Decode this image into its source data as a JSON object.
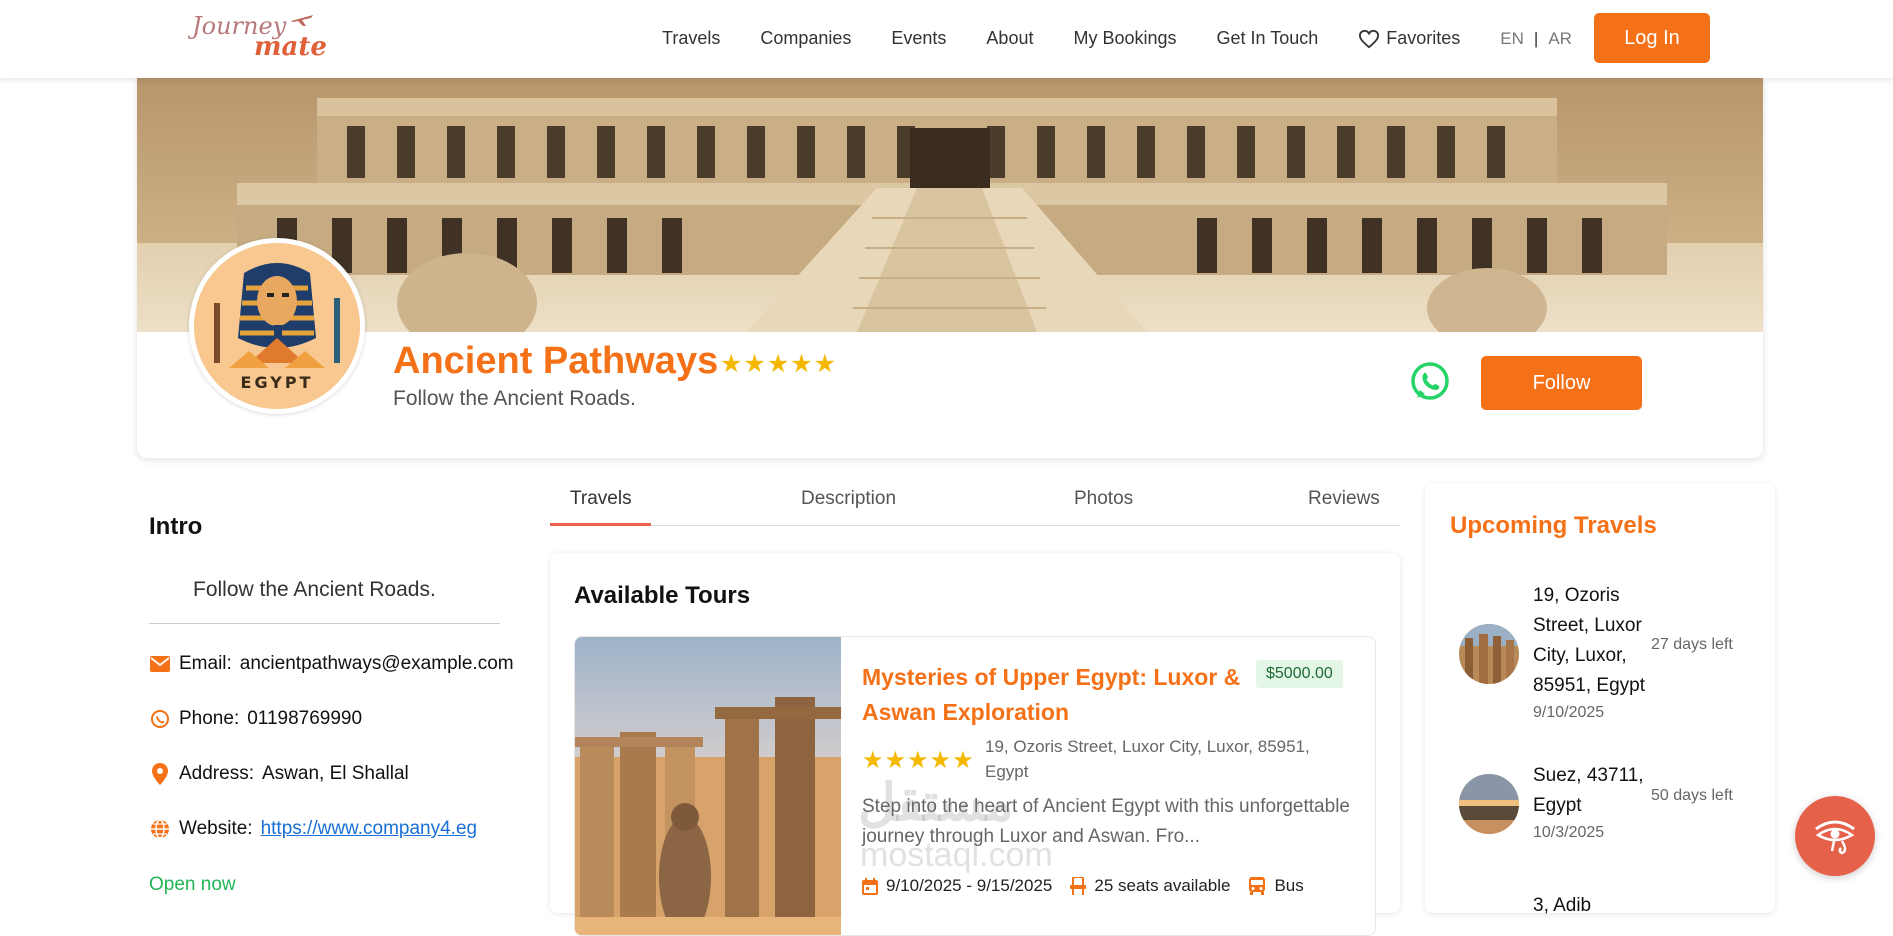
{
  "brand": {
    "logo_line1": "Journey",
    "logo_line2": "mate"
  },
  "nav": {
    "links": [
      "Travels",
      "Companies",
      "Events",
      "About",
      "My Bookings",
      "Get In Touch"
    ],
    "favorites": "Favorites",
    "lang_en": "EN",
    "lang_sep": "|",
    "lang_ar": "AR",
    "login": "Log In"
  },
  "company": {
    "name": "Ancient Pathways",
    "rating_stars": "★★★★★",
    "tagline": "Follow the Ancient Roads.",
    "follow": "Follow",
    "avatar_text": "EGYPT"
  },
  "intro": {
    "title": "Intro",
    "text": "Follow the Ancient Roads.",
    "email_label": "Email:",
    "email": "ancientpathways@example.com",
    "phone_label": "Phone:",
    "phone": "01198769990",
    "address_label": "Address:",
    "address": "Aswan, El Shallal",
    "website_label": "Website:",
    "website": "https://www.company4.eg",
    "status": "Open now"
  },
  "tabs": [
    "Travels",
    "Description",
    "Photos",
    "Reviews"
  ],
  "tours": {
    "title": "Available Tours",
    "items": [
      {
        "title": "Mysteries of Upper Egypt: Luxor & Aswan Exploration",
        "price": "$5000.00",
        "stars": "★★★★★",
        "address": "19, Ozoris Street, Luxor City, Luxor, 85951, Egypt",
        "description": "Step into the heart of Ancient Egypt with this unforgettable journey through Luxor and Aswan. Fro...",
        "dates": "9/10/2025 - 9/15/2025",
        "seats": "25 seats available",
        "transport": "Bus"
      }
    ]
  },
  "upcoming": {
    "title": "Upcoming Travels",
    "items": [
      {
        "address": "19, Ozoris Street, Luxor City, Luxor, 85951, Egypt",
        "date": "9/10/2025",
        "days_left": "27 days left"
      },
      {
        "address": "Suez, 43711, Egypt",
        "date": "10/3/2025",
        "days_left": "50 days left"
      },
      {
        "address": "3, Adib"
      }
    ]
  },
  "watermark": {
    "line1": "مستقل",
    "line2": "mostaql.com"
  },
  "colors": {
    "accent": "#f57117",
    "star": "#f5b800",
    "whatsapp": "#25d366",
    "open": "#22b455",
    "float": "#e6614a"
  }
}
